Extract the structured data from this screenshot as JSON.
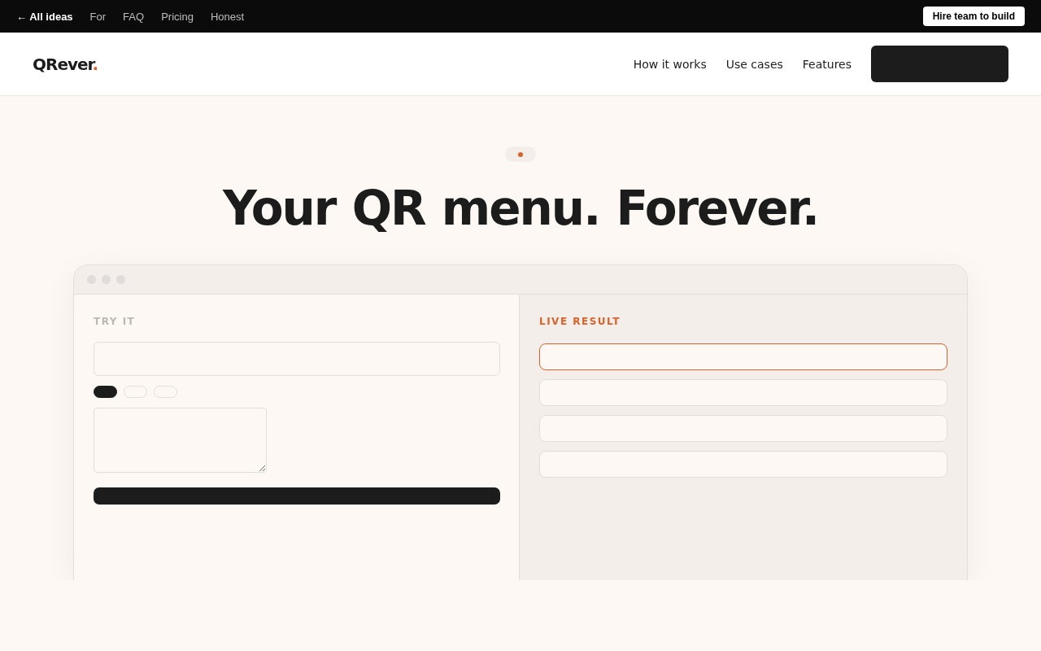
{
  "topbar": {
    "back": "← All ideas",
    "links": [
      "For",
      "FAQ",
      "Pricing",
      "Honest"
    ],
    "cta": "Hire team to build"
  },
  "header": {
    "brand": {
      "name": "QRever",
      "mark": "."
    },
    "nav": [
      "How it works",
      "Use cases",
      "Features"
    ]
  },
  "hero": {
    "title": "Your QR menu. Forever."
  },
  "demo": {
    "input_label": "TRY IT",
    "chips": [
      {
        "selected": true
      },
      {
        "selected": false
      },
      {
        "selected": false
      }
    ],
    "result_label": "LIVE RESULT",
    "results": [
      {
        "selected": true
      },
      {
        "selected": false
      },
      {
        "selected": false
      },
      {
        "selected": false
      }
    ]
  }
}
